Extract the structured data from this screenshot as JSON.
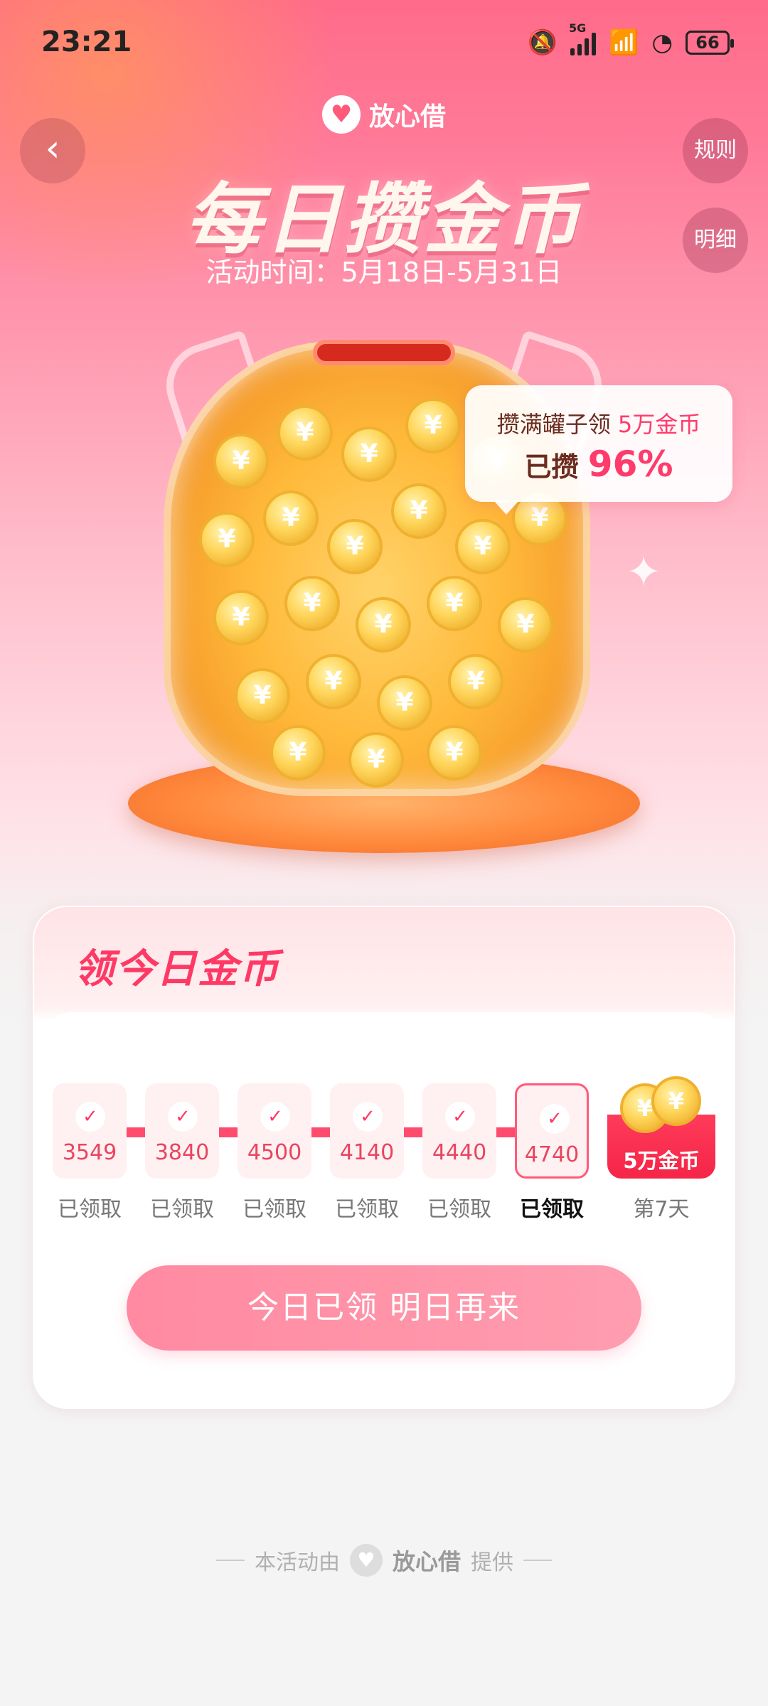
{
  "status_bar": {
    "time": "23:21",
    "network": "5G",
    "battery": "66"
  },
  "header": {
    "back_icon": "‹",
    "brand_name": "放心借",
    "title": "每日攒金币",
    "subtitle": "活动时间：5月18日-5月31日",
    "rules_label": "规则",
    "detail_label": "明细"
  },
  "jar": {
    "bubble_prefix": "攒满罐子领",
    "bubble_reward": "5万金币",
    "saved_label": "已攒",
    "saved_percent": "96%",
    "progress_fraction": 0.96
  },
  "checkin": {
    "title": "领今日金币",
    "days": [
      {
        "amount": "3549",
        "status": "已领取",
        "claimed": true,
        "current": false
      },
      {
        "amount": "3840",
        "status": "已领取",
        "claimed": true,
        "current": false
      },
      {
        "amount": "4500",
        "status": "已领取",
        "claimed": true,
        "current": false
      },
      {
        "amount": "4140",
        "status": "已领取",
        "claimed": true,
        "current": false
      },
      {
        "amount": "4440",
        "status": "已领取",
        "claimed": true,
        "current": false
      },
      {
        "amount": "4740",
        "status": "已领取",
        "claimed": true,
        "current": true
      }
    ],
    "final_day": {
      "reward": "5万金币",
      "label": "第7天"
    },
    "button_label": "今日已领 明日再来"
  },
  "footer": {
    "prefix": "本活动由",
    "brand": "放心借",
    "suffix": "提供"
  },
  "colors": {
    "accent": "#ff3966",
    "button": "#ff8aa1",
    "jar_base": "#ff8a3d"
  }
}
